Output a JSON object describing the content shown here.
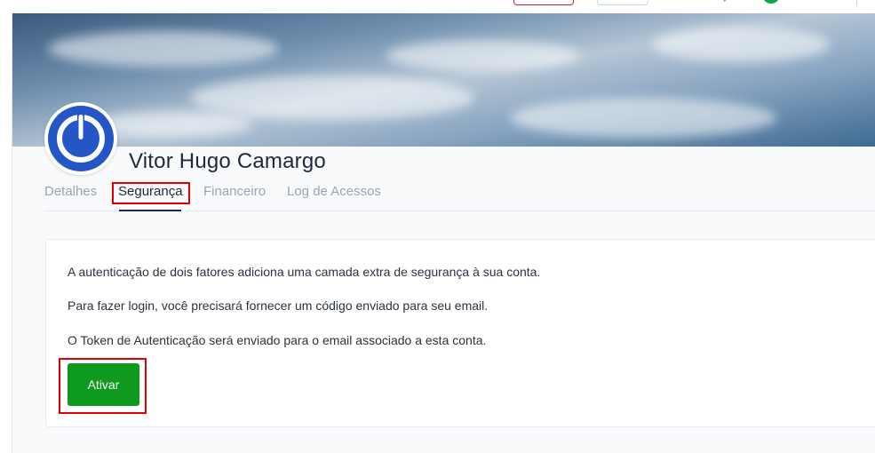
{
  "profile": {
    "name": "Vitor Hugo Camargo"
  },
  "tabs": [
    {
      "label": "Detalhes"
    },
    {
      "label": "Segurança"
    },
    {
      "label": "Financeiro"
    },
    {
      "label": "Log de Acessos"
    }
  ],
  "security": {
    "paragraphs": [
      "A autenticação de dois fatores adiciona uma camada extra de segurança à sua conta.",
      "Para fazer login, você precisará fornecer um código enviado para seu email.",
      "O Token de Autenticação será enviado para o email associado a esta conta."
    ],
    "activate_label": "Ativar"
  },
  "colors": {
    "accent_green": "#0d9a1e",
    "avatar_blue": "#2457c5",
    "highlight_red": "#e00000"
  },
  "icons": {
    "avatar": "power-icon"
  }
}
